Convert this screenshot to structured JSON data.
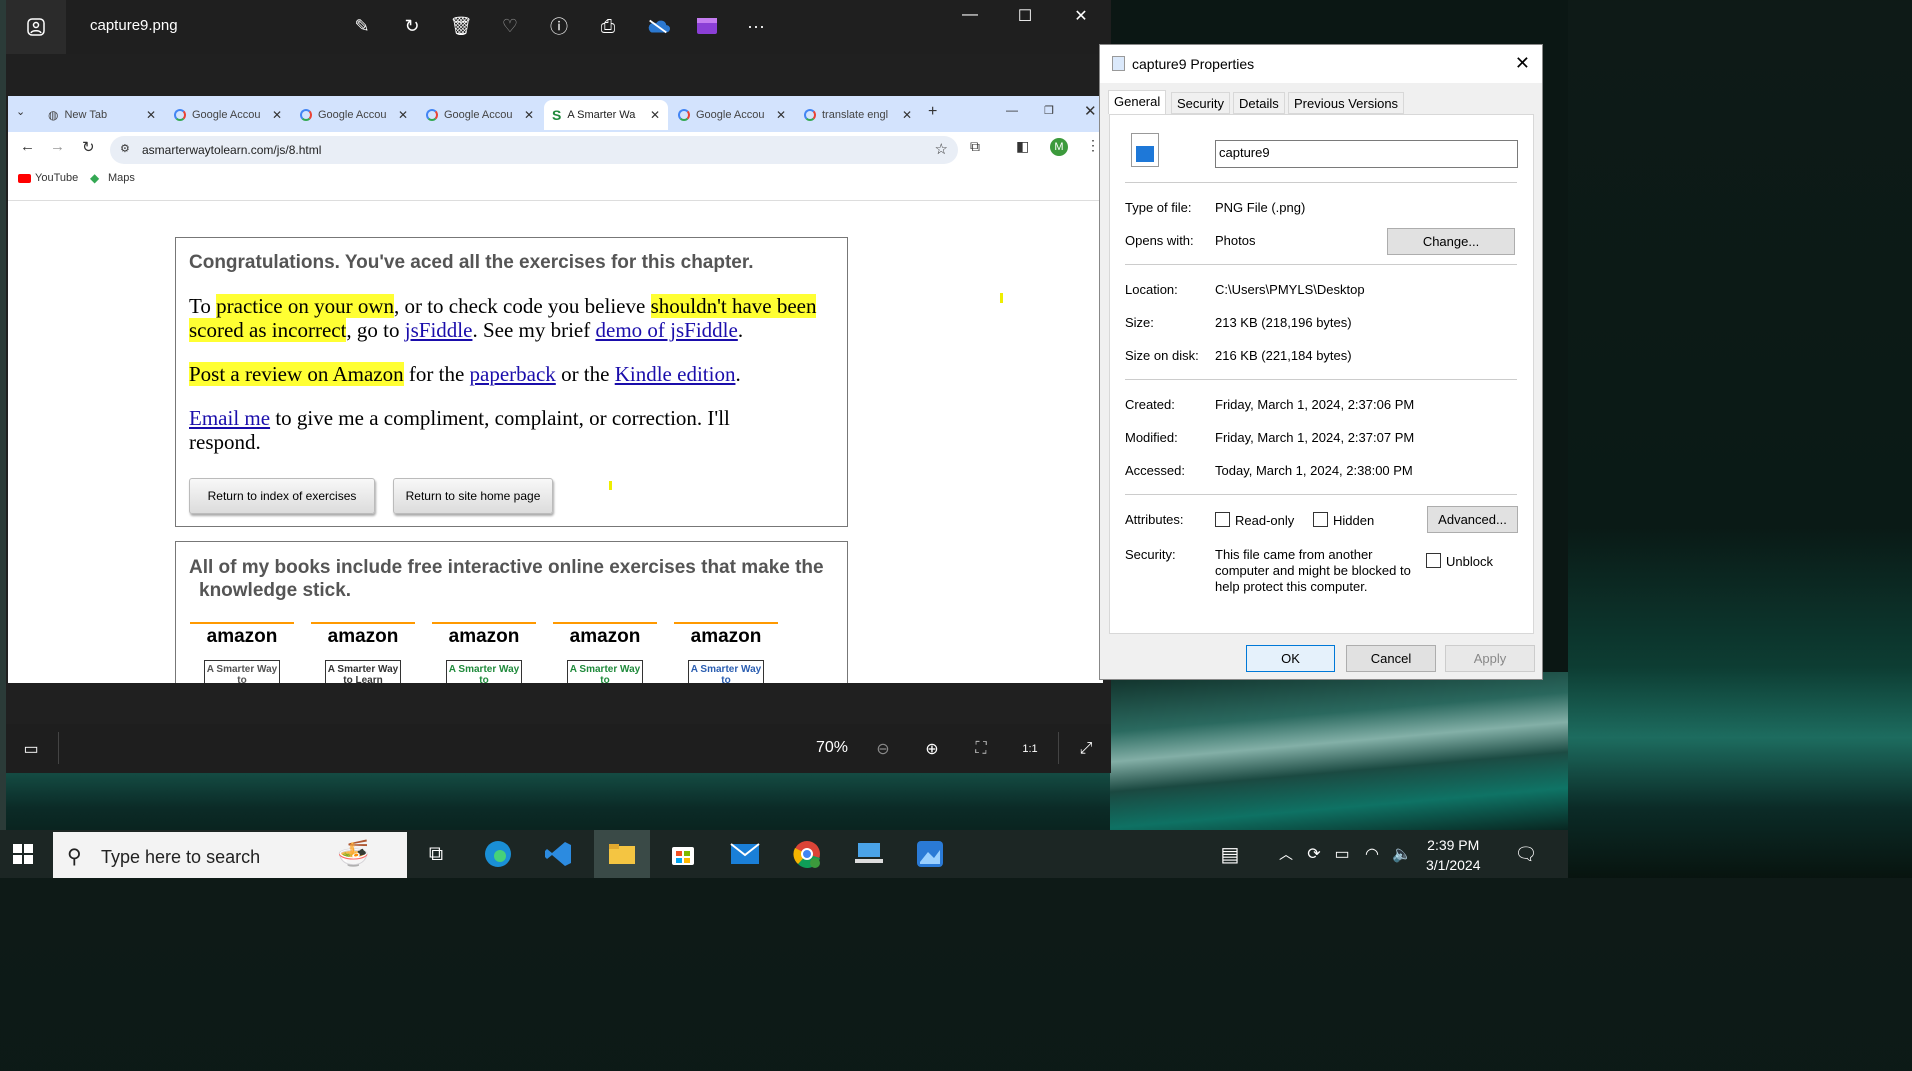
{
  "photos": {
    "filename": "capture9.png",
    "zoom": "70%"
  },
  "browser": {
    "tabs": [
      {
        "label": "New Tab",
        "icon": "globe-icon"
      },
      {
        "label": "Google Accou",
        "icon": "google-icon"
      },
      {
        "label": "Google Accou",
        "icon": "google-icon"
      },
      {
        "label": "Google Accou",
        "icon": "google-icon"
      },
      {
        "label": "A Smarter Wa",
        "icon": "smarter-icon"
      },
      {
        "label": "Google Accou",
        "icon": "google-icon"
      },
      {
        "label": "translate engl",
        "icon": "google-icon"
      }
    ],
    "url": "asmarterwaytolearn.com/js/8.html",
    "profile_initial": "M",
    "bookmarks": [
      "YouTube",
      "Maps"
    ]
  },
  "page": {
    "congrats": "Congratulations. You've aced all the exercises for this chapter.",
    "p1": {
      "a": "To ",
      "hl1": "practice on your own",
      "b": ", or to check code you believe ",
      "hl2": "shouldn't have been scored as incorrect",
      "c": ", go to ",
      "link1": "jsFiddle",
      "d": ". See my brief ",
      "link2": "demo of jsFiddle",
      "e": "."
    },
    "p2": {
      "hl": "Post a review on Amazon",
      "a": " for the ",
      "link1": "paperback",
      "b": " or the ",
      "link2": "Kindle edition",
      "c": "."
    },
    "p3": {
      "link": "Email me",
      "a": " to give me a compliment, complaint, or correction. I'll respond."
    },
    "btn_index": "Return to index of exercises",
    "btn_home": "Return to site home page",
    "books_heading": "All of my books include free interactive online exercises that make the knowledge stick.",
    "books": [
      {
        "brand": "amazon",
        "label": "A Smarter Way to",
        "color": "#555555"
      },
      {
        "brand": "amazon",
        "label": "A Smarter Way to Learn",
        "color": "#333333"
      },
      {
        "brand": "amazon",
        "label": "A Smarter Way to",
        "color": "#1f8a3b"
      },
      {
        "brand": "amazon",
        "label": "A Smarter Way to",
        "color": "#1f8a3b"
      },
      {
        "brand": "amazon",
        "label": "A Smarter Way to",
        "color": "#2a5db0"
      }
    ]
  },
  "dialog": {
    "title": "capture9 Properties",
    "tabs": [
      "General",
      "Security",
      "Details",
      "Previous Versions"
    ],
    "name_value": "capture9",
    "type_label": "Type of file:",
    "type_value": "PNG File (.png)",
    "opens_label": "Opens with:",
    "opens_value": "Photos",
    "change_btn": "Change...",
    "location_label": "Location:",
    "location_value": "C:\\Users\\PMYLS\\Desktop",
    "size_label": "Size:",
    "size_value": "213 KB (218,196 bytes)",
    "disk_label": "Size on disk:",
    "disk_value": "216 KB (221,184 bytes)",
    "created_label": "Created:",
    "created_value": "Friday, March 1, 2024, 2:37:06 PM",
    "modified_label": "Modified:",
    "modified_value": "Friday, March 1, 2024, 2:37:07 PM",
    "accessed_label": "Accessed:",
    "accessed_value": "Today, March 1, 2024, 2:38:00 PM",
    "attributes_label": "Attributes:",
    "readonly": "Read-only",
    "hidden": "Hidden",
    "advanced_btn": "Advanced...",
    "security_label": "Security:",
    "security_text": "This file came from another computer and might be blocked to help protect this computer.",
    "unblock": "Unblock",
    "ok": "OK",
    "cancel": "Cancel",
    "apply": "Apply"
  },
  "taskbar": {
    "search_placeholder": "Type here to search",
    "time": "2:39 PM",
    "date": "3/1/2024"
  }
}
